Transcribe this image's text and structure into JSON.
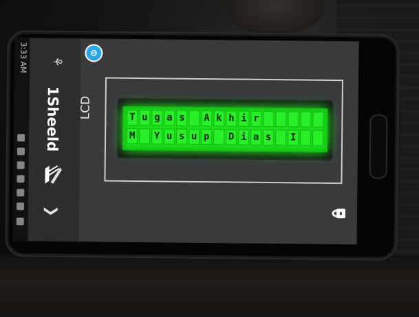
{
  "status": {
    "time": "3:33 AM"
  },
  "app": {
    "title": "1Sheeld"
  },
  "shield": {
    "name": "LCD"
  },
  "lcd": {
    "rows": [
      [
        "T",
        "u",
        "g",
        "a",
        "s",
        " ",
        "A",
        "k",
        "h",
        "i",
        "r",
        " ",
        " ",
        " ",
        " ",
        " "
      ],
      [
        "M",
        " ",
        "Y",
        "u",
        "s",
        "u",
        "p",
        " ",
        "D",
        "i",
        "a",
        "s",
        " ",
        "I",
        " ",
        " "
      ]
    ]
  },
  "colors": {
    "lcd_backlight": "#1cdc1c",
    "badge": "#29a7e8"
  },
  "icons": {
    "settings": "settings-icon",
    "logo": "logo-icon",
    "back": "chevron-down-icon",
    "shield_badge": "shield-badge-icon",
    "lock": "lock-icon"
  }
}
